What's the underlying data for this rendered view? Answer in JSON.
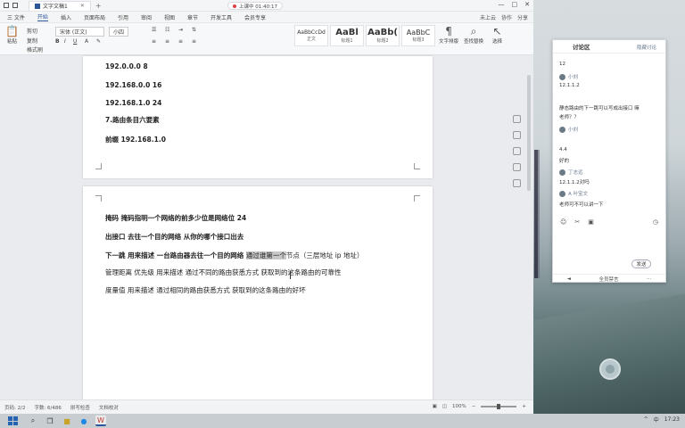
{
  "window": {
    "tab_title": "文字文稿1",
    "recording_badge": "上课中 01:40:17",
    "controls": [
      "—",
      "□",
      "✕"
    ]
  },
  "menu": {
    "items": [
      "三 文件",
      "开始",
      "插入",
      "页面布局",
      "引用",
      "审阅",
      "视图",
      "章节",
      "开发工具",
      "会员专享"
    ],
    "active_index": 1,
    "right_items": [
      "未上云",
      "协作",
      "分享"
    ]
  },
  "ribbon": {
    "paste": "粘贴",
    "cut": "剪切",
    "copy": "复制",
    "format_painter": "格式刷",
    "font_name": "宋体 (正文)",
    "font_size": "小四",
    "style_previews": [
      {
        "preview": "AaBbCcDd",
        "label": "正文",
        "big": false
      },
      {
        "preview": "AaBl",
        "label": "标题1",
        "big": true
      },
      {
        "preview": "AaBb(",
        "label": "标题2",
        "big": true
      },
      {
        "preview": "AaBbC",
        "label": "标题3",
        "big": false
      }
    ],
    "text_tools": "文字排版",
    "find_replace": "查找替换",
    "select": "选择"
  },
  "document": {
    "page1_lines": [
      "192.0.0.0 8",
      "192.168.0.0 16",
      "192.168.1.0 24",
      "7.路由条目六要素",
      "前缀  192.168.1.0"
    ],
    "page2": {
      "line1": "掩码  掩码指明一个网络的前多少位是网络位  24",
      "line2": "出接口  去往一个目的网络  从你的哪个接口出去",
      "line3_a": "下一跳   用来描述   一台路由器去往一个目的网络   ",
      "line3_hl": "通过谁第一个",
      "line3_b": "节点（三层地址 ip 地址）",
      "line4": "管理距离  优先级    用来描述  通过不同的路由获悉方式  获取到的这条路由的可靠性",
      "line5": "度量值   用来描述   通过相同的路由获悉方式  获取到的这条路由的好坏"
    }
  },
  "status": {
    "page": "页码: 2/2",
    "words": "字数: 6/486",
    "spell": "拼写检查",
    "doc_check": "文档校对",
    "zoom": "100%"
  },
  "chat": {
    "title": "讨论区",
    "subtitle": "隐藏讨论",
    "messages": [
      {
        "type": "text",
        "text": "12"
      },
      {
        "type": "name",
        "text": "小刘"
      },
      {
        "type": "text",
        "text": "12.1.1.2"
      },
      {
        "type": "text",
        "text": "静态路由的下一跳可以写成出接口 嘛"
      },
      {
        "type": "text",
        "text": "老师？？"
      },
      {
        "type": "name",
        "text": "小刘"
      },
      {
        "type": "text",
        "text": "4.4"
      },
      {
        "type": "text",
        "text": "好的"
      },
      {
        "type": "name",
        "text": "丁志远"
      },
      {
        "type": "text",
        "text": "12.1.1.2对吗"
      },
      {
        "type": "name",
        "text": "A 叶宝文"
      },
      {
        "type": "text",
        "text": "老师可不可以讲一下"
      }
    ],
    "send_label": "发送",
    "footer": [
      "◄",
      "全员禁言",
      "···"
    ]
  },
  "taskbar": {
    "icons": [
      "搜索",
      "任务视图",
      "文件夹",
      "浏览器",
      "WPS"
    ],
    "tray": [
      "^",
      "中",
      "17:23"
    ]
  }
}
